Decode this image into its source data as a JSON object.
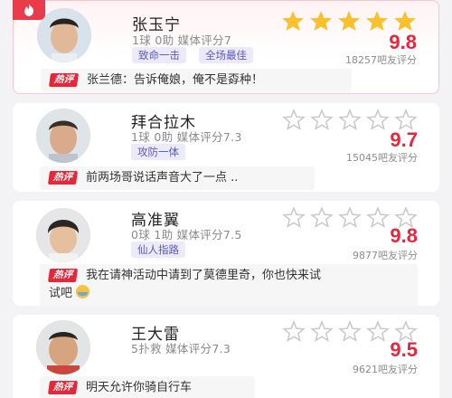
{
  "icons": {
    "corner_badge": "flame-icon",
    "star_filled_color": "#f9c12e",
    "star_empty_color": "#c9c9c9",
    "score_color": "#e8263a"
  },
  "hot_label": "热评",
  "players": [
    {
      "name": "张玉宁",
      "stats": "1球 0助  媒体评分7",
      "tags": [
        "致命一击",
        "全场最佳"
      ],
      "stars_filled": 5,
      "score": "9.8",
      "count": "18257吧友评分",
      "comment": "张兰德：告诉俺娘，俺不是孬种！"
    },
    {
      "name": "拜合拉木",
      "stats": "1球 0助  媒体评分7.3",
      "tags": [
        "攻防一体"
      ],
      "stars_filled": 0,
      "score": "9.7",
      "count": "15045吧友评分",
      "comment": "前两场哥说话声音大了一点 .."
    },
    {
      "name": "高准翼",
      "stats": "0球 1助  媒体评分7.5",
      "tags": [
        "仙人指路"
      ],
      "stars_filled": 0,
      "score": "9.8",
      "count": "9877吧友评分",
      "comment_line1": "我在请神活动中请到了莫德里奇，你也快来试",
      "comment_line2": "试吧"
    },
    {
      "name": "王大雷",
      "stats": "5扑救  媒体评分7.3",
      "tags": [],
      "stars_filled": 0,
      "score": "9.5",
      "count": "9621吧友评分",
      "comment": "明天允许你骑自行车"
    }
  ]
}
